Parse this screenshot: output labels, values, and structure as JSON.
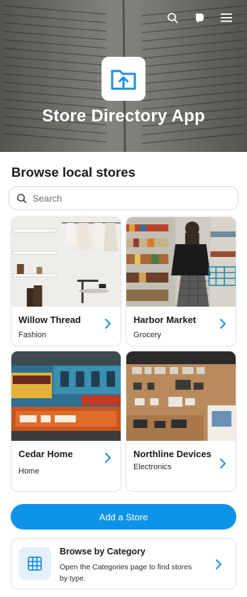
{
  "header": {
    "app_title": "Store Directory App",
    "icons": [
      "search-icon",
      "chat-icon",
      "menu-icon"
    ],
    "logo_icon": "folder-upload-icon"
  },
  "browse": {
    "title": "Browse local stores",
    "search_placeholder": "Search"
  },
  "stores": [
    {
      "name": "Willow Thread",
      "category": "Fashion"
    },
    {
      "name": "Harbor Market",
      "category": "Grocery"
    },
    {
      "name": "Cedar Home",
      "category": "Home"
    },
    {
      "name": "Northline Devices",
      "category": "Electronics"
    }
  ],
  "actions": {
    "add_store_label": "Add a Store"
  },
  "category_card": {
    "title": "Browse by Category",
    "description": "Open the Categories page to find stores by type.",
    "icon": "grid-icon"
  },
  "colors": {
    "accent": "#0d94e8",
    "icon_tint": "#1c8fe0",
    "category_icon_bg": "#e4f1fb"
  }
}
